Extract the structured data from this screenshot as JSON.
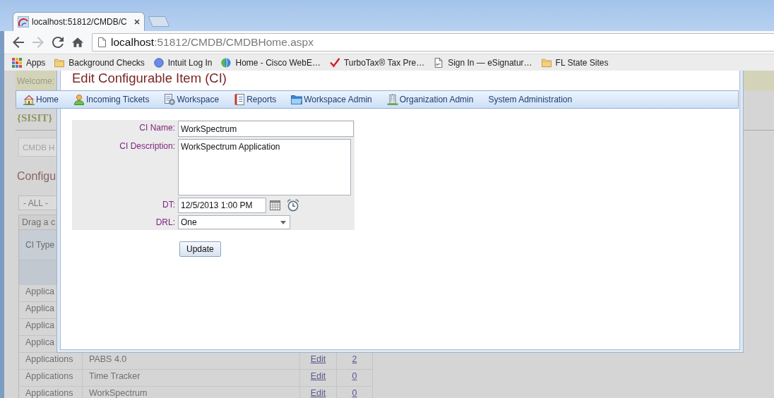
{
  "browser": {
    "tabs": [
      {
        "title": "localhost:51812/CMDB/C",
        "selected": true
      }
    ],
    "nav_buttons": [
      {
        "kind": "back",
        "disabled": false
      },
      {
        "kind": "forward",
        "disabled": true
      },
      {
        "kind": "reload",
        "disabled": false
      },
      {
        "kind": "home",
        "disabled": false
      }
    ],
    "address": {
      "host": "localhost",
      "path": ":51812/CMDB/CMDBHome.aspx"
    },
    "bookmarks": [
      {
        "kind": "apps",
        "label": "Apps"
      },
      {
        "kind": "folder",
        "label": "Background Checks"
      },
      {
        "kind": "dot",
        "label": "Intuit Log In"
      },
      {
        "kind": "globe",
        "label": "Home - Cisco WebE…"
      },
      {
        "kind": "tick",
        "label": "TurboTax® Tax Pre…"
      },
      {
        "kind": "document",
        "label": "Sign In — eSignatur…"
      },
      {
        "kind": "folder",
        "label": "FL State Sites"
      }
    ]
  },
  "page": {
    "welcome": "Welcome:",
    "menu": [
      {
        "kind": "home",
        "label": "Home"
      },
      {
        "kind": "user",
        "label": "Incoming Tickets"
      },
      {
        "kind": "workspace",
        "label": "Workspace"
      },
      {
        "kind": "reports",
        "label": "Reports"
      },
      {
        "kind": "folder",
        "label": "Workspace Admin"
      },
      {
        "kind": "building",
        "label": "Organization Admin"
      },
      {
        "kind": "plain",
        "label": "System Administration"
      }
    ],
    "brand": "{SISIT}",
    "breadcrumb": "CMDB H",
    "heading": "Configu",
    "filter": {
      "value": "- ALL -"
    },
    "grid": {
      "group_panel": "Drag a c",
      "columns": [
        "CI Type"
      ],
      "partial_rows": [
        {
          "ci_type": "Applica"
        },
        {
          "ci_type": "Applica"
        },
        {
          "ci_type": "Applica"
        },
        {
          "ci_type": "Applica"
        }
      ],
      "rows": [
        {
          "ci_type": "Applications",
          "column_2": "PABS 4.0",
          "column_3": "Edit",
          "column_4": "2"
        },
        {
          "ci_type": "Applications",
          "column_2": "Time Tracker",
          "column_3": "Edit",
          "column_4": "0"
        },
        {
          "ci_type": "Applications",
          "column_2": "WorkSpectrum",
          "column_3": "Edit",
          "column_4": "0"
        }
      ]
    }
  },
  "dialog": {
    "title": "Edit Configurable Item (CI)",
    "fields": [
      {
        "kind": "text",
        "label": "CI Name:",
        "value": "WorkSpectrum"
      },
      {
        "kind": "textarea",
        "label": "CI Description:",
        "value": "WorkSpectrum Application"
      },
      {
        "kind": "datetime",
        "label": "DT:",
        "value": "12/5/2013 1:00 PM"
      },
      {
        "kind": "select",
        "label": "DRL:",
        "value": "One"
      }
    ],
    "buttons": [
      "Update"
    ]
  }
}
